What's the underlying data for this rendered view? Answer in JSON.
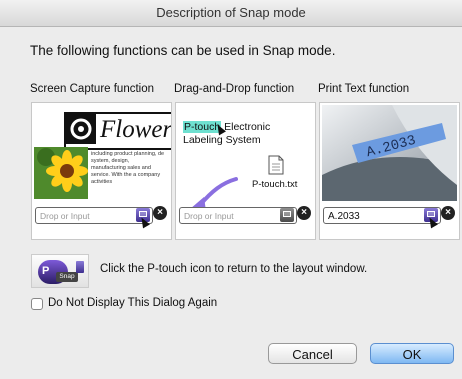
{
  "window": {
    "title": "Description of Snap mode"
  },
  "intro": "The following functions can be used in Snap mode.",
  "panels": [
    {
      "label": "Screen Capture function",
      "heading": "Flower",
      "body_text": "including product planning, de system, design, manufacturing sales and service. With the a company activities",
      "input_placeholder": "Drop or Input"
    },
    {
      "label": "Drag-and-Drop function",
      "highlight_text": "P-touch",
      "text_rest_line1": "Electronic",
      "text_line2": "Labeling System",
      "file_name": "P-touch.txt",
      "input_placeholder": "Drop or Input"
    },
    {
      "label": "Print Text function",
      "tape_text": "A.2033",
      "input_value": "A.2033"
    }
  ],
  "icon_badge": "Snap",
  "hint": "Click the P-touch icon to return to the layout window.",
  "checkbox_label": "Do Not Display This Dialog Again",
  "buttons": {
    "cancel": "Cancel",
    "ok": "OK"
  },
  "colors": {
    "highlight": "#6fe0d0",
    "accent_purple": "#6b50c8",
    "ok_blue": "#7fb8f2"
  },
  "icons": [
    "close-icon",
    "print-icon",
    "drag-arrow-icon",
    "file-icon",
    "cursor-icon",
    "ptouch-icon"
  ]
}
